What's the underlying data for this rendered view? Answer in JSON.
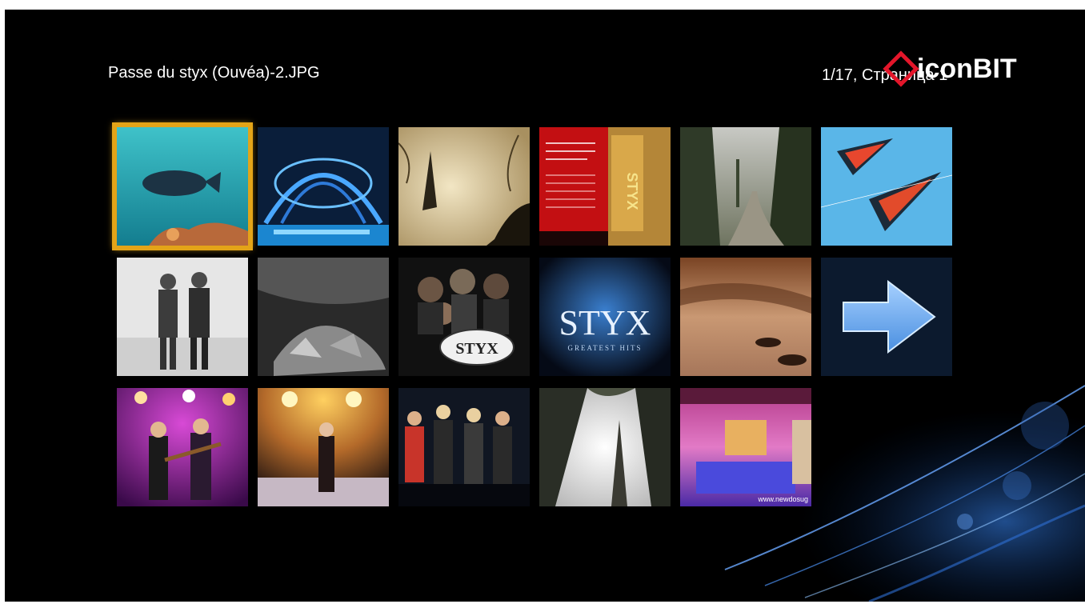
{
  "header": {
    "filename": "Passe du styx (Ouvéa)-2.JPG",
    "page_info": "1/17, Страница 1",
    "brand": "iconBIT"
  },
  "colors": {
    "background": "#000000",
    "selection_border": "#e3a418",
    "brand_red": "#e3162a"
  },
  "thumbnails": [
    {
      "name": "underwater-fish-thumbnail",
      "icon": "photo-icon",
      "selected": true
    },
    {
      "name": "glass-dome-thumbnail",
      "icon": "photo-icon",
      "selected": false
    },
    {
      "name": "misty-lake-figure-thumbnail",
      "icon": "photo-icon",
      "selected": false
    },
    {
      "name": "styx-dvd-cover-thumbnail",
      "icon": "photo-icon",
      "selected": false
    },
    {
      "name": "forest-road-thumbnail",
      "icon": "photo-icon",
      "selected": false
    },
    {
      "name": "kites-sky-thumbnail",
      "icon": "photo-icon",
      "selected": false
    },
    {
      "name": "two-soldiers-bw-thumbnail",
      "icon": "photo-icon",
      "selected": false
    },
    {
      "name": "bw-debris-thumbnail",
      "icon": "photo-icon",
      "selected": false
    },
    {
      "name": "styx-band-cover-thumbnail",
      "icon": "photo-icon",
      "selected": false
    },
    {
      "name": "styx-greatest-hits-thumbnail",
      "icon": "photo-icon",
      "selected": false
    },
    {
      "name": "sepia-beach-thumbnail",
      "icon": "photo-icon",
      "selected": false
    },
    {
      "name": "next-page-arrow-tile",
      "icon": "arrow-right-icon",
      "selected": false
    },
    {
      "name": "concert-guitarists-thumbnail",
      "icon": "photo-icon",
      "selected": false
    },
    {
      "name": "concert-stage-lights-thumbnail",
      "icon": "photo-icon",
      "selected": false
    },
    {
      "name": "band-on-stage-thumbnail",
      "icon": "photo-icon",
      "selected": false
    },
    {
      "name": "tall-trees-fog-thumbnail",
      "icon": "photo-icon",
      "selected": false
    },
    {
      "name": "neon-pool-room-thumbnail",
      "icon": "photo-icon",
      "selected": false
    }
  ],
  "thumbnail_texts": {
    "dvd_text": "STYX",
    "greatest_hits_title": "STYX",
    "greatest_hits_subtitle": "GREATEST HITS",
    "band_cover_logo": "STYX",
    "pool_watermark": "www.newdosug"
  }
}
